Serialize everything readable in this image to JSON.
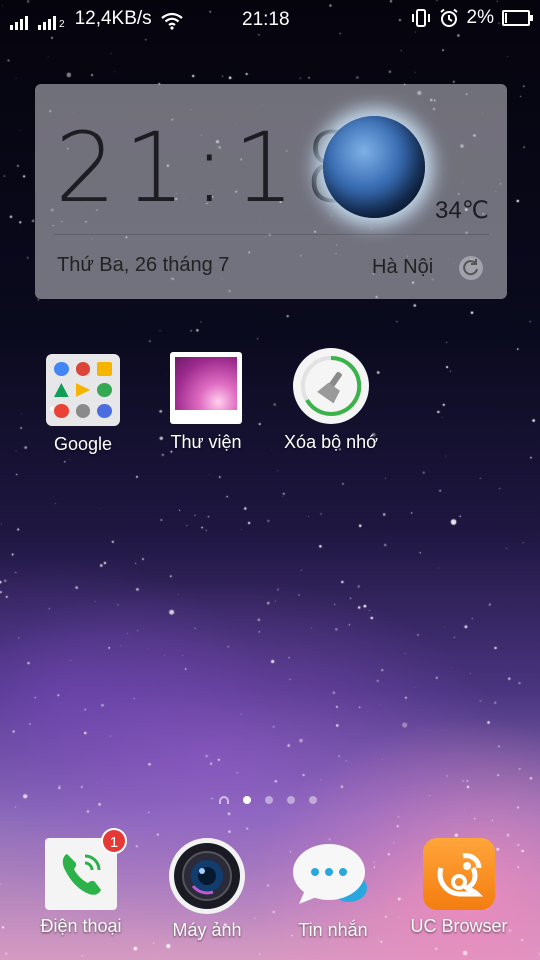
{
  "status_bar": {
    "net_speed": "12,4KB/s",
    "time": "21:18",
    "battery_percent": "2%",
    "battery_level": 0.02,
    "sim2_label": "2",
    "icons": [
      "signal-sim1-icon",
      "signal-sim2-icon",
      "wifi-icon",
      "vibrate-icon",
      "alarm-icon",
      "battery-icon"
    ]
  },
  "clock_widget": {
    "time": "21:18",
    "temperature": "34℃",
    "date": "Thứ Ba, 26 tháng 7",
    "city": "Hà Nội",
    "icons": [
      "weather-planet-icon",
      "refresh-icon"
    ]
  },
  "apps": [
    {
      "label": "Google",
      "icon": "google-folder-icon"
    },
    {
      "label": "Thư viện",
      "icon": "gallery-icon"
    },
    {
      "label": "Xóa bộ nhớ",
      "icon": "cleaner-icon"
    }
  ],
  "pager": {
    "page_count": 4,
    "active_page": 1
  },
  "dock": [
    {
      "label": "Điện thoại",
      "icon": "phone-icon",
      "badge": "1"
    },
    {
      "label": "Máy ảnh",
      "icon": "camera-icon"
    },
    {
      "label": "Tin nhắn",
      "icon": "messages-icon"
    },
    {
      "label": "UC Browser",
      "icon": "uc-browser-icon"
    }
  ],
  "colors": {
    "badge": "#e53935",
    "phone_green": "#2db24a",
    "uc_orange": "#f47d10",
    "cleaner_ring": "#3cb34a",
    "messages_blue": "#29a8e0"
  }
}
